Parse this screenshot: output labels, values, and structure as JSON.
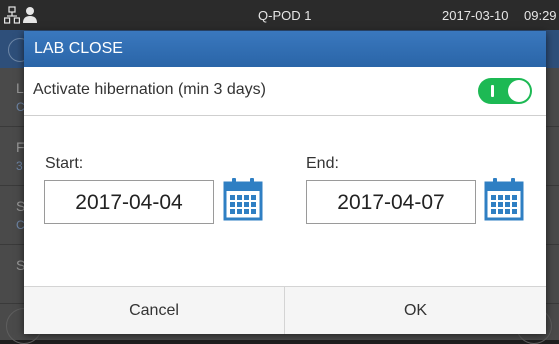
{
  "statusbar": {
    "device_name": "Q-POD 1",
    "date": "2017-03-10",
    "time": "09:29",
    "icons": [
      "network-icon",
      "user-icon"
    ]
  },
  "background": {
    "rows": [
      {
        "l1": "L",
        "l2": "C"
      },
      {
        "l1": "F",
        "l2": "3"
      },
      {
        "l1": "S",
        "l2": "C"
      },
      {
        "l1": "S",
        "l2": ""
      }
    ]
  },
  "dialog": {
    "title": "LAB CLOSE",
    "hibernation_label": "Activate hibernation (min 3 days)",
    "hibernation_enabled": true,
    "toggle_on_text": "I",
    "start_label": "Start:",
    "start_value": "2017-04-04",
    "end_label": "End:",
    "end_value": "2017-04-07",
    "cancel_label": "Cancel",
    "ok_label": "OK"
  },
  "colors": {
    "header": "#2a65a8",
    "toggle_on": "#1db954",
    "calendar_icon": "#2f7fc3"
  }
}
